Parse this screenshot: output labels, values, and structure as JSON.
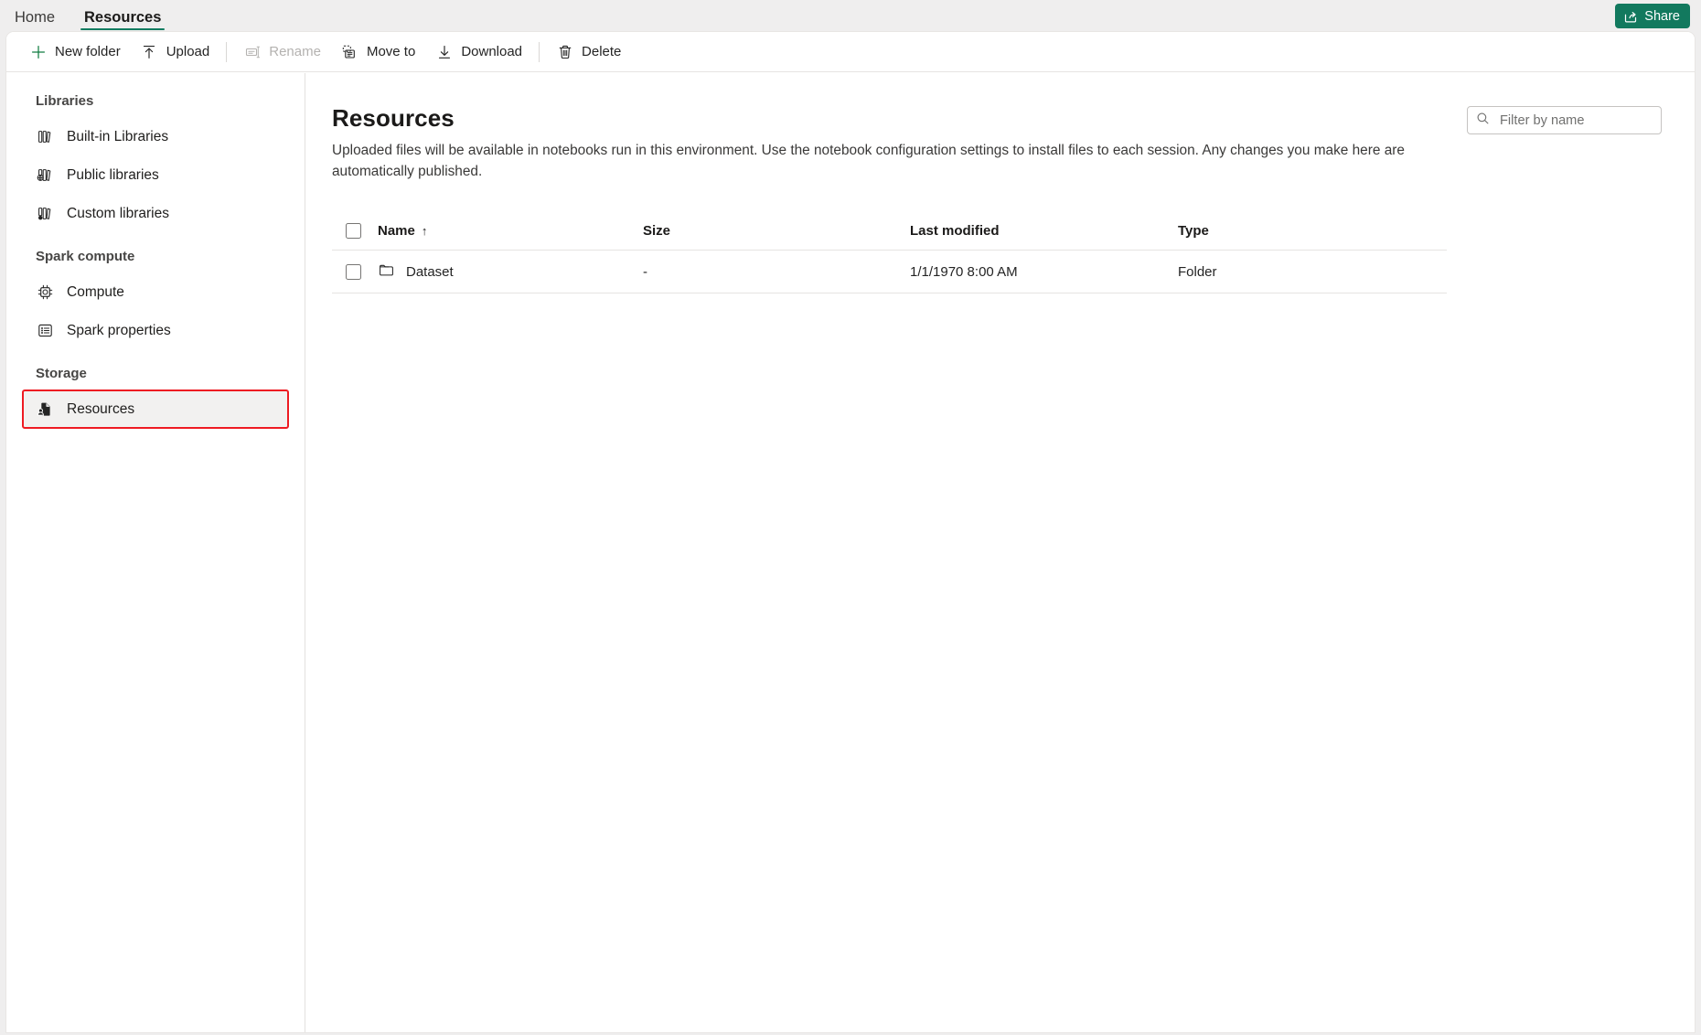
{
  "tabs": [
    {
      "label": "Home",
      "active": false
    },
    {
      "label": "Resources",
      "active": true
    }
  ],
  "share": {
    "label": "Share",
    "icon": "share-icon",
    "color": "#12795e"
  },
  "toolbar": {
    "items": [
      {
        "label": "New folder",
        "icon": "plus-icon",
        "disabled": false,
        "sep_after": false,
        "accent": "#107c41"
      },
      {
        "label": "Upload",
        "icon": "upload-icon",
        "disabled": false,
        "sep_after": true
      },
      {
        "label": "Rename",
        "icon": "rename-icon",
        "disabled": true,
        "sep_after": false
      },
      {
        "label": "Move to",
        "icon": "move-to-icon",
        "disabled": false,
        "sep_after": false
      },
      {
        "label": "Download",
        "icon": "download-icon",
        "disabled": false,
        "sep_after": true
      },
      {
        "label": "Delete",
        "icon": "trash-icon",
        "disabled": false,
        "sep_after": false
      }
    ]
  },
  "sidebar": {
    "groups": [
      {
        "title": "Libraries",
        "items": [
          {
            "label": "Built-in Libraries",
            "icon": "books-icon",
            "selected": false
          },
          {
            "label": "Public libraries",
            "icon": "public-library-icon",
            "selected": false
          },
          {
            "label": "Custom libraries",
            "icon": "custom-library-icon",
            "selected": false
          }
        ]
      },
      {
        "title": "Spark compute",
        "items": [
          {
            "label": "Compute",
            "icon": "chip-icon",
            "selected": false
          },
          {
            "label": "Spark properties",
            "icon": "properties-list-icon",
            "selected": false
          }
        ]
      },
      {
        "title": "Storage",
        "items": [
          {
            "label": "Resources",
            "icon": "resources-icon",
            "selected": true
          }
        ]
      }
    ],
    "selection_highlight_color": "#ee1b22"
  },
  "main": {
    "title": "Resources",
    "description": "Uploaded files will be available in notebooks run in this environment. Use the notebook configuration settings to install files to each session. Any changes you make here are automatically published.",
    "filter": {
      "placeholder": "Filter by name",
      "value": "",
      "icon": "search-icon"
    },
    "table": {
      "columns": [
        {
          "label": "Name",
          "sorted": true,
          "sort_direction": "↑"
        },
        {
          "label": "Size",
          "sorted": false
        },
        {
          "label": "Last modified",
          "sorted": false
        },
        {
          "label": "Type",
          "sorted": false
        }
      ],
      "rows": [
        {
          "name": "Dataset",
          "icon": "folder-icon",
          "size": "-",
          "last_modified": "1/1/1970 8:00 AM",
          "type": "Folder",
          "checked": false
        }
      ]
    }
  }
}
